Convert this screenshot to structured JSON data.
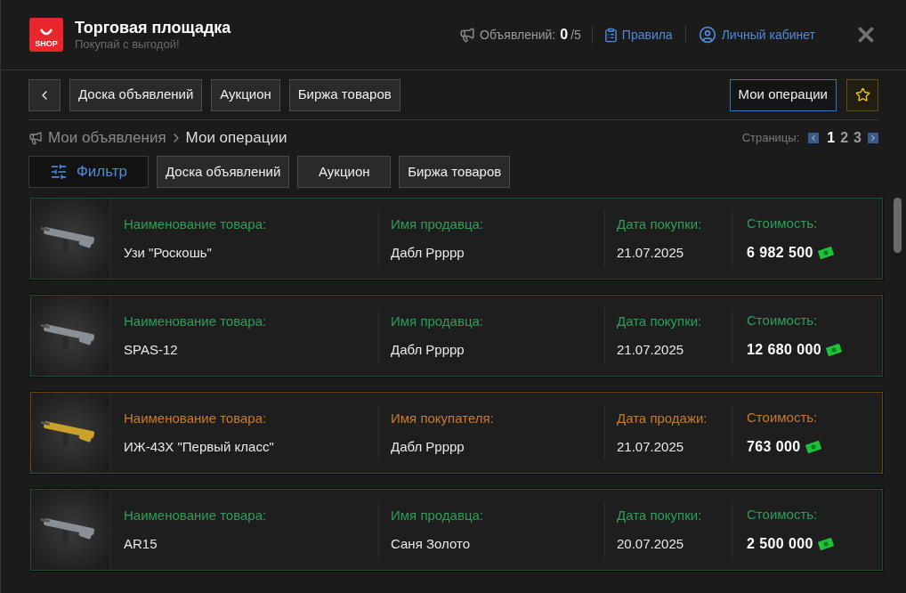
{
  "header": {
    "logo": "SHOP",
    "title": "Торговая площадка",
    "subtitle": "Покупай с выгодой!",
    "ads_label": "Объявлений:",
    "ads_count": "0",
    "ads_limit": "/5",
    "rules": "Правила",
    "account": "Личный кабинет"
  },
  "nav": {
    "tabs": [
      {
        "label": "Доска объявлений",
        "selected": false
      },
      {
        "label": "Аукцион",
        "selected": false
      },
      {
        "label": "Биржа товаров",
        "selected": false
      }
    ],
    "my_operations": {
      "label": "Мои операции",
      "selected": true
    }
  },
  "breadcrumb": [
    "Мои объявления",
    "Мои операции"
  ],
  "pagination": {
    "label": "Страницы:",
    "pages": [
      {
        "label": "1",
        "selected": true
      },
      {
        "label": "2",
        "selected": false
      },
      {
        "label": "3",
        "selected": false
      }
    ]
  },
  "filter": {
    "label": "Фильтр",
    "categories": [
      "Доска объявлений",
      "Аукцион",
      "Биржа товаров"
    ]
  },
  "operations": [
    {
      "kind": "purchase",
      "item_label": "Наименование товара:",
      "item": "Узи \"Роскошь\"",
      "person_label": "Имя продавца:",
      "person": "Дабл Ррррр",
      "date_label": "Дата покупки:",
      "date": "21.07.2025",
      "price_label": "Стоимость:",
      "price": "6 982 500"
    },
    {
      "kind": "purchase",
      "item_label": "Наименование товара:",
      "item": "SPAS-12",
      "person_label": "Имя продавца:",
      "person": "Дабл Ррррр",
      "date_label": "Дата покупки:",
      "date": "21.07.2025",
      "price_label": "Стоимость:",
      "price": "12 680 000"
    },
    {
      "kind": "sale",
      "item_label": "Наименование товара:",
      "item": "ИЖ-43Х \"Первый класс\"",
      "person_label": "Имя покупателя:",
      "person": "Дабл Ррррр",
      "date_label": "Дата продажи:",
      "date": "21.07.2025",
      "price_label": "Стоимость:",
      "price": "763 000"
    },
    {
      "kind": "purchase",
      "item_label": "Наименование товара:",
      "item": "AR15",
      "person_label": "Имя продавца:",
      "person": "Саня Золото",
      "date_label": "Дата покупки:",
      "date": "20.07.2025",
      "price_label": "Стоимость:",
      "price": "2 500 000"
    }
  ]
}
